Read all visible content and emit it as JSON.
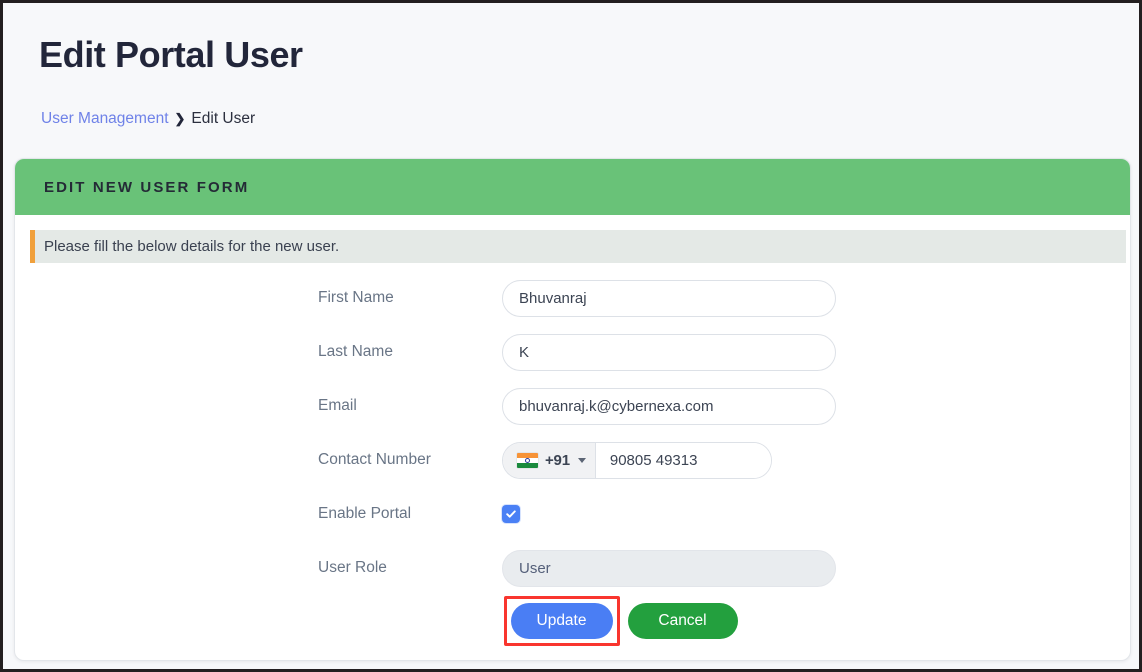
{
  "page": {
    "title": "Edit Portal User",
    "breadcrumb": {
      "link_label": "User Management",
      "separator": "❯",
      "current_label": "Edit User"
    }
  },
  "card": {
    "header_title": "EDIT NEW USER FORM",
    "header_color": "#69c278",
    "alert": {
      "text": "Please fill the below details for the new user.",
      "accent_color": "#f0a03c",
      "background_color": "#e4e9e6"
    }
  },
  "form": {
    "fields": [
      {
        "label": "First Name",
        "value": "Bhuvanraj",
        "placeholder": "First Name"
      },
      {
        "label": "Last Name",
        "value": "K",
        "placeholder": "Last Name"
      },
      {
        "label": "Email",
        "value": "bhuvanraj.k@cybernexa.com",
        "placeholder": "Email"
      },
      {
        "label": "Contact Number",
        "value": "90805 49313",
        "placeholder": "Contact Number"
      },
      {
        "label": "Enable Portal",
        "value": "",
        "placeholder": ""
      },
      {
        "label": "User Role",
        "value": "User",
        "placeholder": "User Role"
      }
    ],
    "phone": {
      "country_flag": "india-flag-icon",
      "country_code": "+91",
      "dropdown_icon": "chevron-down-icon",
      "number": "90805 49313"
    },
    "enable_portal": {
      "checked": true,
      "check_icon": "check-icon",
      "color": "#4a80f5"
    },
    "user_role": {
      "value": "User",
      "readonly": true
    }
  },
  "actions": {
    "update_label": "Update",
    "update_color": "#4a7ef4",
    "cancel_label": "Cancel",
    "cancel_color": "#23a03e",
    "highlight_color": "#f9352e"
  }
}
